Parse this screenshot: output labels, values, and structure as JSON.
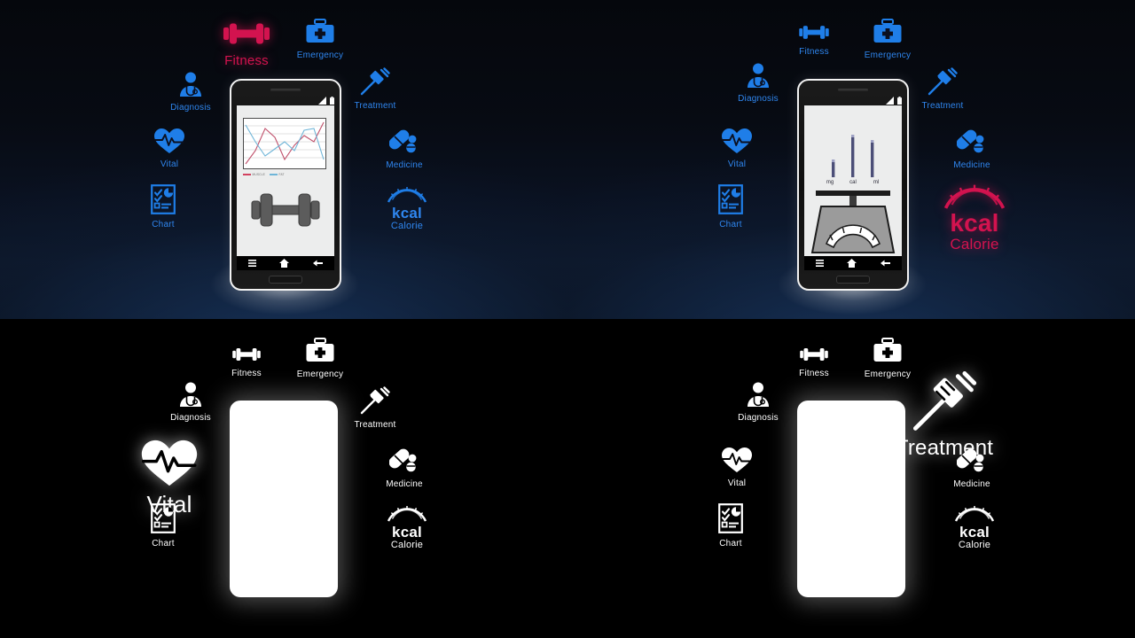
{
  "meta": {
    "colors": {
      "blue": "#1f7ee8",
      "pink": "#d3134f",
      "white": "#ffffff",
      "bg_top": "#0a1120",
      "bg_bottom": "#000000",
      "screen_bg": "#eceded"
    }
  },
  "icon_labels": {
    "fitness": "Fitness",
    "emergency": "Emergency",
    "diagnosis": "Diagnosis",
    "treatment": "Treatment",
    "vital": "Vital",
    "medicine": "Medicine",
    "chart": "Chart",
    "kcal": "kcal",
    "calorie": "Calorie"
  },
  "icon_names": {
    "fitness": "dumbbell-icon",
    "emergency": "first-aid-kit-icon",
    "diagnosis": "doctor-stethoscope-icon",
    "treatment": "syringe-icon",
    "vital": "heart-pulse-icon",
    "medicine": "pill-capsule-icon",
    "chart": "clipboard-chart-icon",
    "calorie": "kcal-gauge-icon"
  },
  "panels": [
    {
      "id": "top-left",
      "theme": "blue",
      "highlight": "fitness",
      "highlight_color": "#d3134f",
      "phone": "fitness-app",
      "phone_state": "on"
    },
    {
      "id": "top-right",
      "theme": "blue",
      "highlight": "calorie",
      "highlight_color": "#d3134f",
      "phone": "scale-app",
      "phone_state": "on"
    },
    {
      "id": "bottom-left",
      "theme": "white",
      "highlight": "vital",
      "highlight_color": "#ffffff",
      "phone": "blank",
      "phone_state": "blank"
    },
    {
      "id": "bottom-right",
      "theme": "white",
      "highlight": "treatment",
      "highlight_color": "#ffffff",
      "phone": "blank",
      "phone_state": "blank"
    }
  ],
  "phone_ui": {
    "nav_items": [
      "menu-icon",
      "home-icon",
      "back-icon"
    ],
    "status_icons": [
      "signal-icon",
      "battery-icon"
    ]
  },
  "chart_data": {
    "type": "line",
    "title": "",
    "xlabel": "",
    "ylabel": "",
    "grid": true,
    "legend_position": "bottom-left",
    "x": [
      0,
      1,
      2,
      3,
      4,
      5,
      6,
      7,
      8
    ],
    "series": [
      {
        "name": "MUSCLE",
        "color": "#c0506b",
        "values": [
          12,
          36,
          76,
          58,
          20,
          46,
          64,
          52,
          90
        ]
      },
      {
        "name": "FAT",
        "color": "#6fb5d8",
        "values": [
          84,
          58,
          30,
          44,
          56,
          40,
          74,
          78,
          22
        ]
      }
    ],
    "ylim": [
      0,
      100
    ]
  },
  "scale_app": {
    "type": "bar",
    "categories": [
      "mg",
      "cal",
      "ml"
    ],
    "values": [
      34,
      85,
      72
    ],
    "ylim": [
      0,
      100
    ],
    "device": "kitchen-scale",
    "bar_color": "#4c4f78"
  }
}
